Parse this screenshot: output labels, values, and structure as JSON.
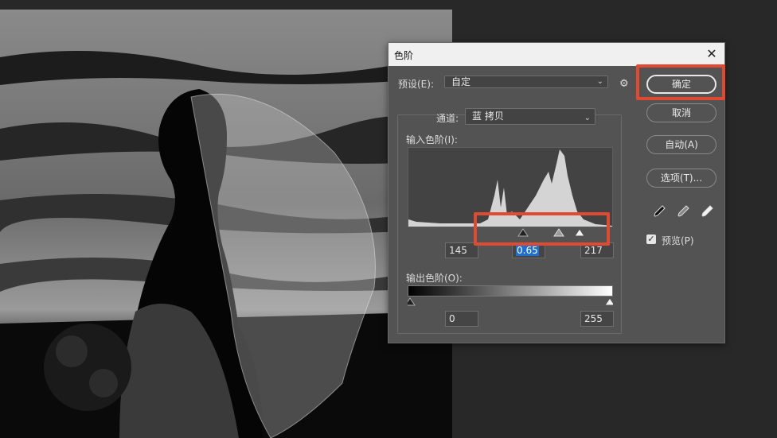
{
  "dialog": {
    "title": "色阶",
    "close_glyph": "✕",
    "preset_label": "预设(E):",
    "preset_value": "自定",
    "channel_label": "通道:",
    "channel_value": "蓝 拷贝",
    "input_levels_label": "输入色阶(I):",
    "input_black": "145",
    "input_gamma": "0.65",
    "input_white": "217",
    "output_levels_label": "输出色阶(O):",
    "output_black": "0",
    "output_white": "255",
    "preview_label": "预览(P)",
    "preview_checked": true
  },
  "buttons": {
    "ok": "确定",
    "cancel": "取消",
    "auto": "自动(A)",
    "options": "选项(T)..."
  },
  "icons": {
    "settings": "gear-icon",
    "black_eyedropper": "black-point-eyedropper-icon",
    "gray_eyedropper": "gray-point-eyedropper-icon",
    "white_eyedropper": "white-point-eyedropper-icon"
  },
  "colors": {
    "dialog_bg": "#535353",
    "annotation": "#e04a33",
    "highlight_field": "#1f6fd1"
  }
}
